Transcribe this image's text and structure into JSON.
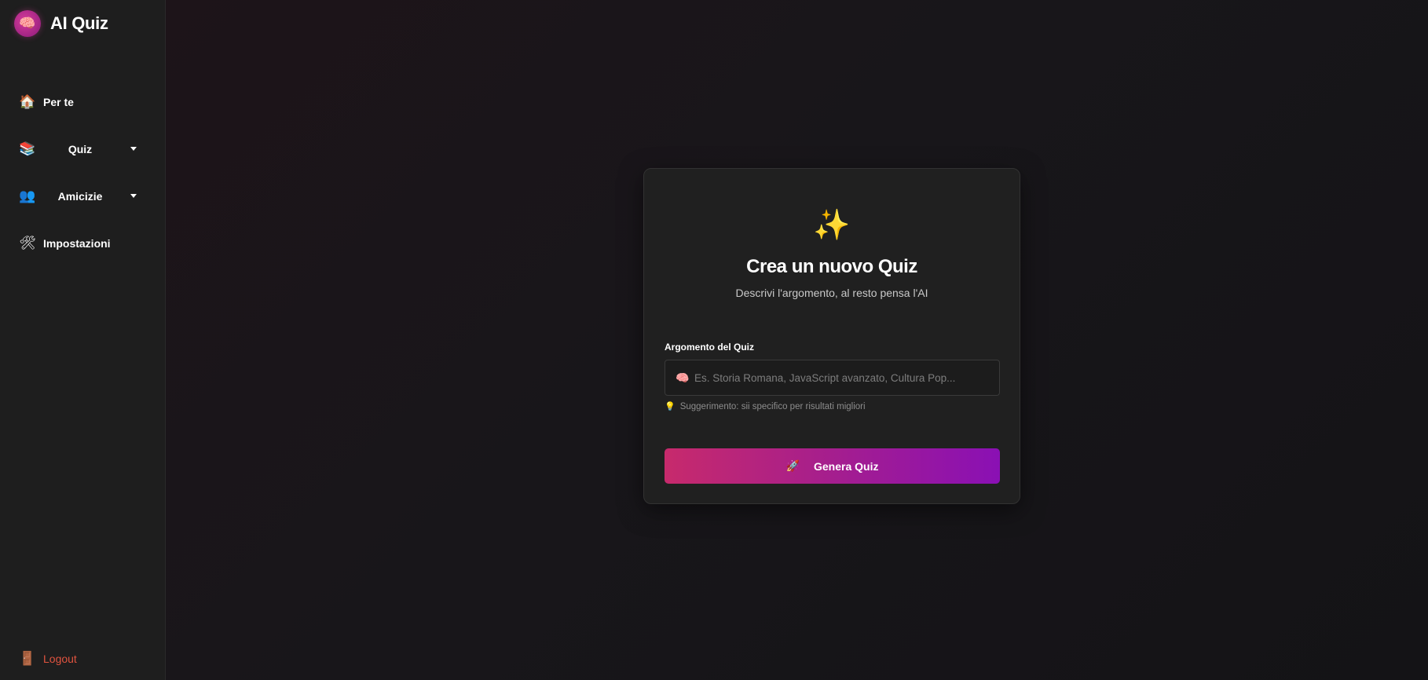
{
  "app": {
    "title": "AI Quiz",
    "logo_icon": "🧠"
  },
  "sidebar": {
    "items": [
      {
        "label": "Per te",
        "icon": "🏠",
        "icon_name": "home-icon"
      },
      {
        "label": "Quiz",
        "icon": "📚",
        "icon_name": "books-icon",
        "dropdown": true
      },
      {
        "label": "Amicizie",
        "icon": "👥",
        "icon_name": "friends-icon",
        "dropdown": true
      },
      {
        "label": "Impostazioni",
        "icon": "🛠",
        "icon_name": "tools-icon"
      }
    ],
    "logout": {
      "label": "Logout",
      "icon": "🚪",
      "color": "#e0533f"
    }
  },
  "card": {
    "icon": "✨",
    "title": "Crea un nuovo Quiz",
    "subtitle": "Descrivi l'argomento, al resto pensa l'AI",
    "field_label": "Argomento del Quiz",
    "input_icon": "🧠",
    "input_value": "",
    "input_placeholder": "Es. Storia Romana, JavaScript avanzato, Cultura Pop...",
    "hint_icon": "💡",
    "hint": "Suggerimento: sii specifico per risultati migliori",
    "button_icon": "🚀",
    "button_label": "Genera Quiz"
  },
  "colors": {
    "accent_start": "#c72a6c",
    "accent_end": "#8a10b4",
    "logout": "#e0533f"
  }
}
